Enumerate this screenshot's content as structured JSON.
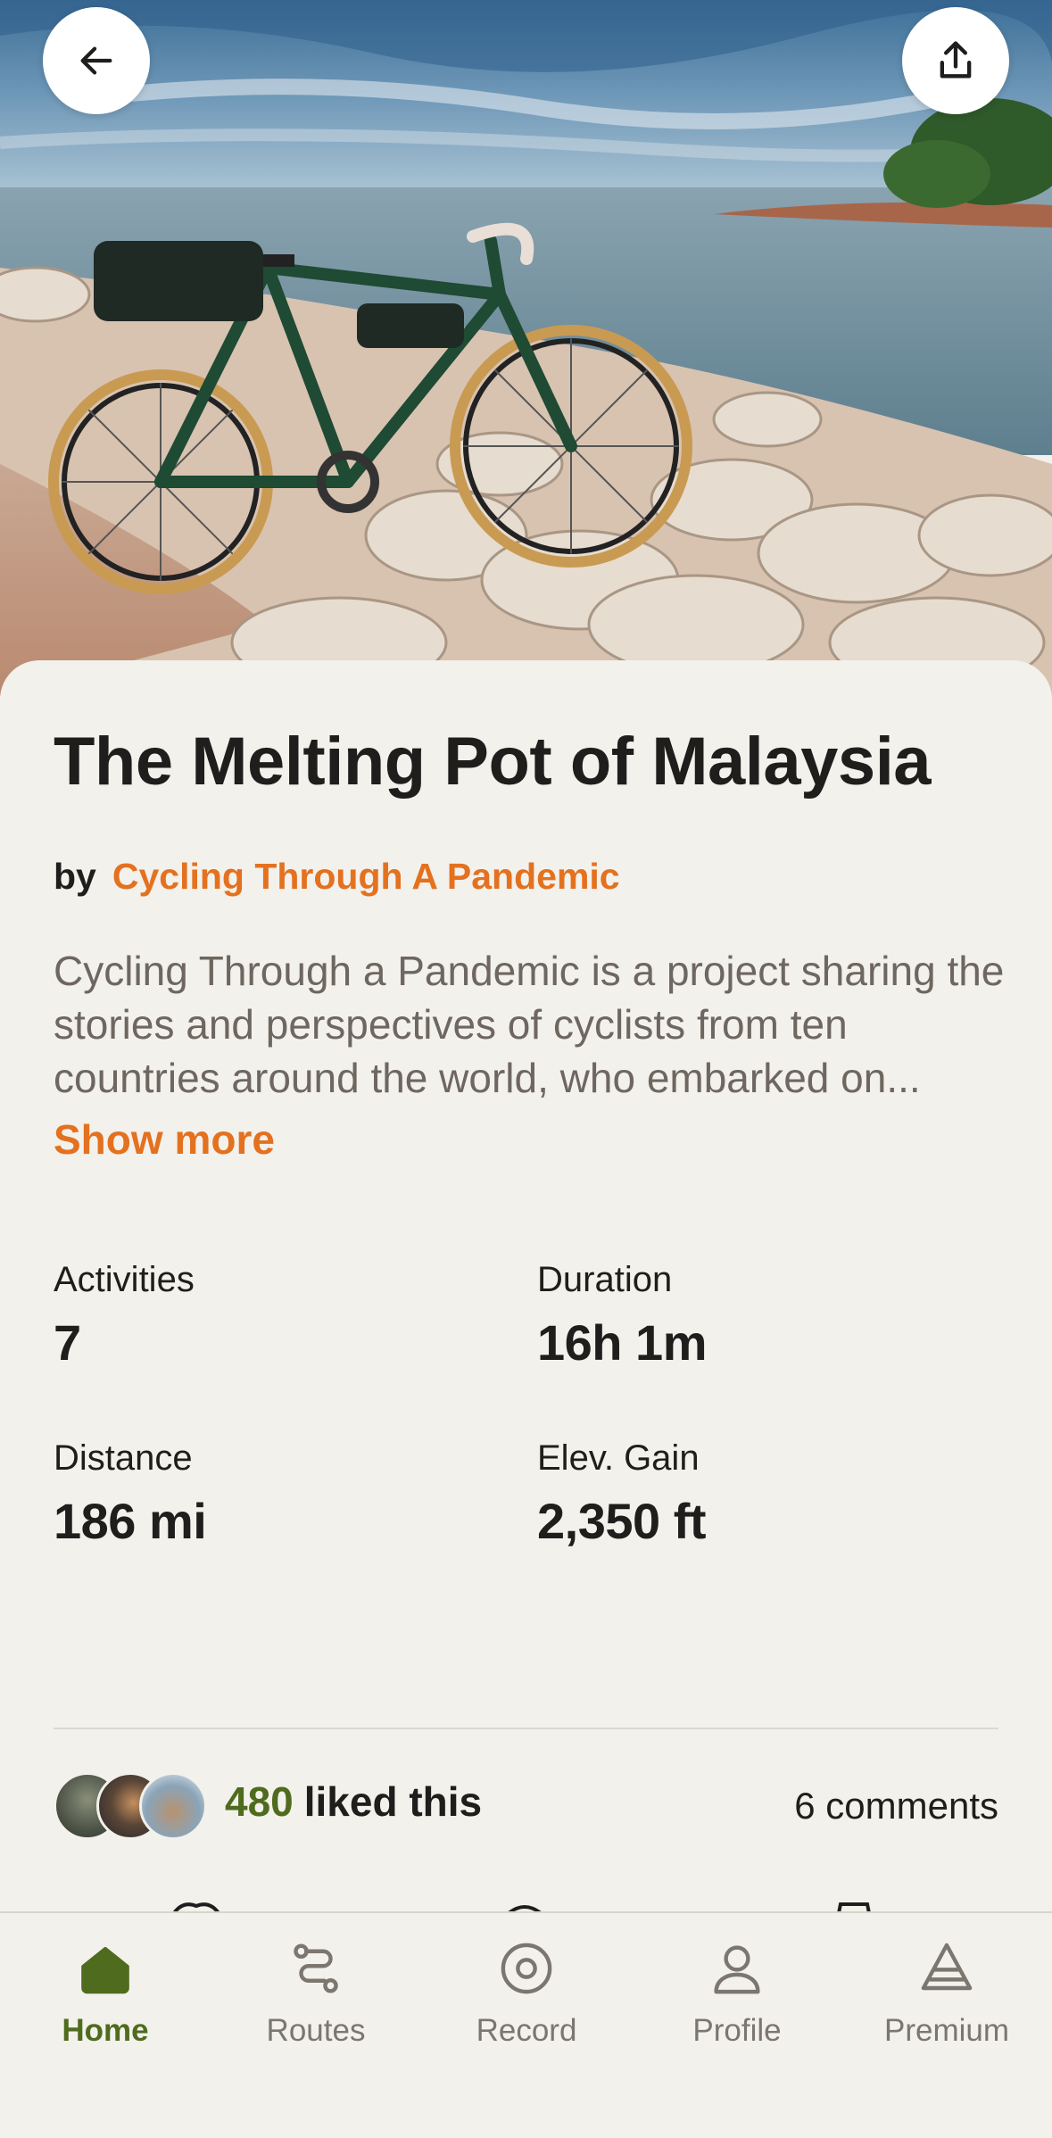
{
  "header": {
    "back_icon": "arrow-left-icon",
    "share_icon": "share-upload-icon"
  },
  "hero": {
    "image": "bicycle-on-rocky-shoreline-photo"
  },
  "collection": {
    "title": "The Melting Pot of Malaysia",
    "by_label": "by",
    "author": "Cycling Through A Pandemic",
    "description": "Cycling Through a Pandemic is a project sharing the stories and perspectives of cyclists from ten countries around the world, who embarked on...",
    "show_more": "Show more"
  },
  "stats": [
    {
      "label": "Activities",
      "value": "7"
    },
    {
      "label": "Duration",
      "value": "16h 1m"
    },
    {
      "label": "Distance",
      "value": "186 mi"
    },
    {
      "label": "Elev. Gain",
      "value": "2,350 ft"
    }
  ],
  "social": {
    "likes_count": "480",
    "likes_text": "liked this",
    "comments": "6 comments"
  },
  "nav": [
    {
      "label": "Home",
      "icon": "home-icon",
      "active": true
    },
    {
      "label": "Routes",
      "icon": "routes-icon",
      "active": false
    },
    {
      "label": "Record",
      "icon": "record-icon",
      "active": false
    },
    {
      "label": "Profile",
      "icon": "profile-icon",
      "active": false
    },
    {
      "label": "Premium",
      "icon": "premium-icon",
      "active": false
    }
  ],
  "colors": {
    "accent_orange": "#e4711f",
    "active_green": "#4f6b1e",
    "background": "#f3f1ec"
  }
}
